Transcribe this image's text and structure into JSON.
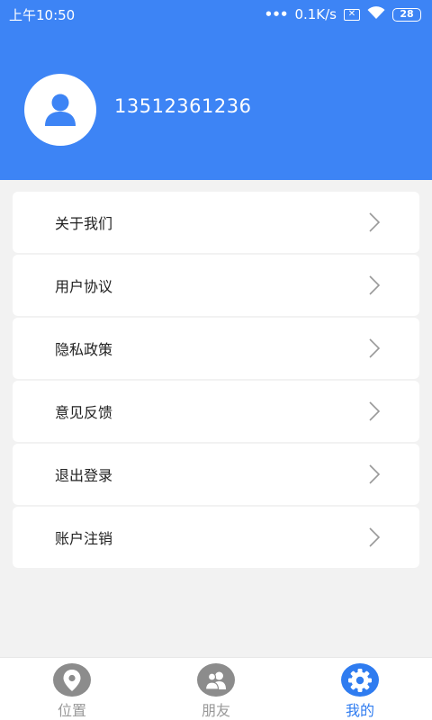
{
  "status_bar": {
    "time": "上午10:50",
    "network_speed": "0.1K/s",
    "battery": "28"
  },
  "profile": {
    "phone": "13512361236"
  },
  "menu": {
    "items": [
      {
        "label": "关于我们"
      },
      {
        "label": "用户协议"
      },
      {
        "label": "隐私政策"
      },
      {
        "label": "意见反馈"
      },
      {
        "label": "退出登录"
      },
      {
        "label": "账户注销"
      }
    ]
  },
  "tabbar": {
    "tabs": [
      {
        "label": "位置",
        "icon": "location-icon"
      },
      {
        "label": "朋友",
        "icon": "friends-icon"
      },
      {
        "label": "我的",
        "icon": "settings-gear-icon",
        "active": true
      }
    ]
  },
  "colors": {
    "primary": "#3d84f5",
    "active_tab": "#2f7cf0",
    "inactive_tab": "#8c8c8c",
    "background": "#f2f2f2"
  }
}
